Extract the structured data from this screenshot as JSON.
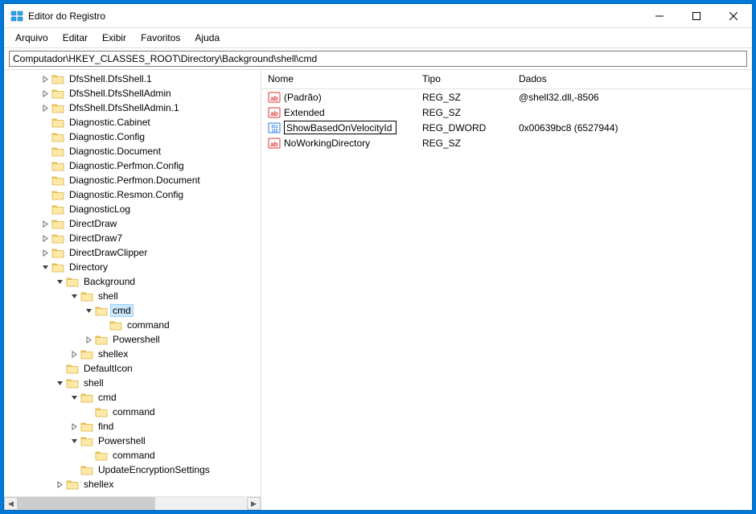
{
  "window": {
    "title": "Editor do Registro"
  },
  "menu": {
    "items": [
      "Arquivo",
      "Editar",
      "Exibir",
      "Favoritos",
      "Ajuda"
    ]
  },
  "address": {
    "path": "Computador\\HKEY_CLASSES_ROOT\\Directory\\Background\\shell\\cmd"
  },
  "tree": {
    "nodes": [
      {
        "indent": 2,
        "exp": ">",
        "label": "DfsShell.DfsShell.1"
      },
      {
        "indent": 2,
        "exp": ">",
        "label": "DfsShell.DfsShellAdmin"
      },
      {
        "indent": 2,
        "exp": ">",
        "label": "DfsShell.DfsShellAdmin.1"
      },
      {
        "indent": 2,
        "exp": "",
        "label": "Diagnostic.Cabinet"
      },
      {
        "indent": 2,
        "exp": "",
        "label": "Diagnostic.Config"
      },
      {
        "indent": 2,
        "exp": "",
        "label": "Diagnostic.Document"
      },
      {
        "indent": 2,
        "exp": "",
        "label": "Diagnostic.Perfmon.Config"
      },
      {
        "indent": 2,
        "exp": "",
        "label": "Diagnostic.Perfmon.Document"
      },
      {
        "indent": 2,
        "exp": "",
        "label": "Diagnostic.Resmon.Config"
      },
      {
        "indent": 2,
        "exp": "",
        "label": "DiagnosticLog"
      },
      {
        "indent": 2,
        "exp": ">",
        "label": "DirectDraw"
      },
      {
        "indent": 2,
        "exp": ">",
        "label": "DirectDraw7"
      },
      {
        "indent": 2,
        "exp": ">",
        "label": "DirectDrawClipper"
      },
      {
        "indent": 2,
        "exp": "v",
        "label": "Directory"
      },
      {
        "indent": 3,
        "exp": "v",
        "label": "Background"
      },
      {
        "indent": 4,
        "exp": "v",
        "label": "shell"
      },
      {
        "indent": 5,
        "exp": "v",
        "label": "cmd",
        "selected": true
      },
      {
        "indent": 6,
        "exp": "",
        "label": "command"
      },
      {
        "indent": 5,
        "exp": ">",
        "label": "Powershell"
      },
      {
        "indent": 4,
        "exp": ">",
        "label": "shellex"
      },
      {
        "indent": 3,
        "exp": "",
        "label": "DefaultIcon"
      },
      {
        "indent": 3,
        "exp": "v",
        "label": "shell"
      },
      {
        "indent": 4,
        "exp": "v",
        "label": "cmd"
      },
      {
        "indent": 5,
        "exp": "",
        "label": "command"
      },
      {
        "indent": 4,
        "exp": ">",
        "label": "find"
      },
      {
        "indent": 4,
        "exp": "v",
        "label": "Powershell"
      },
      {
        "indent": 5,
        "exp": "",
        "label": "command"
      },
      {
        "indent": 4,
        "exp": "",
        "label": "UpdateEncryptionSettings"
      },
      {
        "indent": 3,
        "exp": ">",
        "label": "shellex"
      }
    ]
  },
  "list": {
    "headers": {
      "name": "Nome",
      "type": "Tipo",
      "data": "Dados"
    },
    "rows": [
      {
        "icon": "string",
        "name": "(Padrão)",
        "type": "REG_SZ",
        "data": "@shell32.dll,-8506",
        "editing": false
      },
      {
        "icon": "string",
        "name": "Extended",
        "type": "REG_SZ",
        "data": "",
        "editing": false
      },
      {
        "icon": "dword",
        "name": "ShowBasedOnVelocityId",
        "type": "REG_DWORD",
        "data": "0x00639bc8 (6527944)",
        "editing": true
      },
      {
        "icon": "string",
        "name": "NoWorkingDirectory",
        "type": "REG_SZ",
        "data": "",
        "editing": false
      }
    ]
  }
}
